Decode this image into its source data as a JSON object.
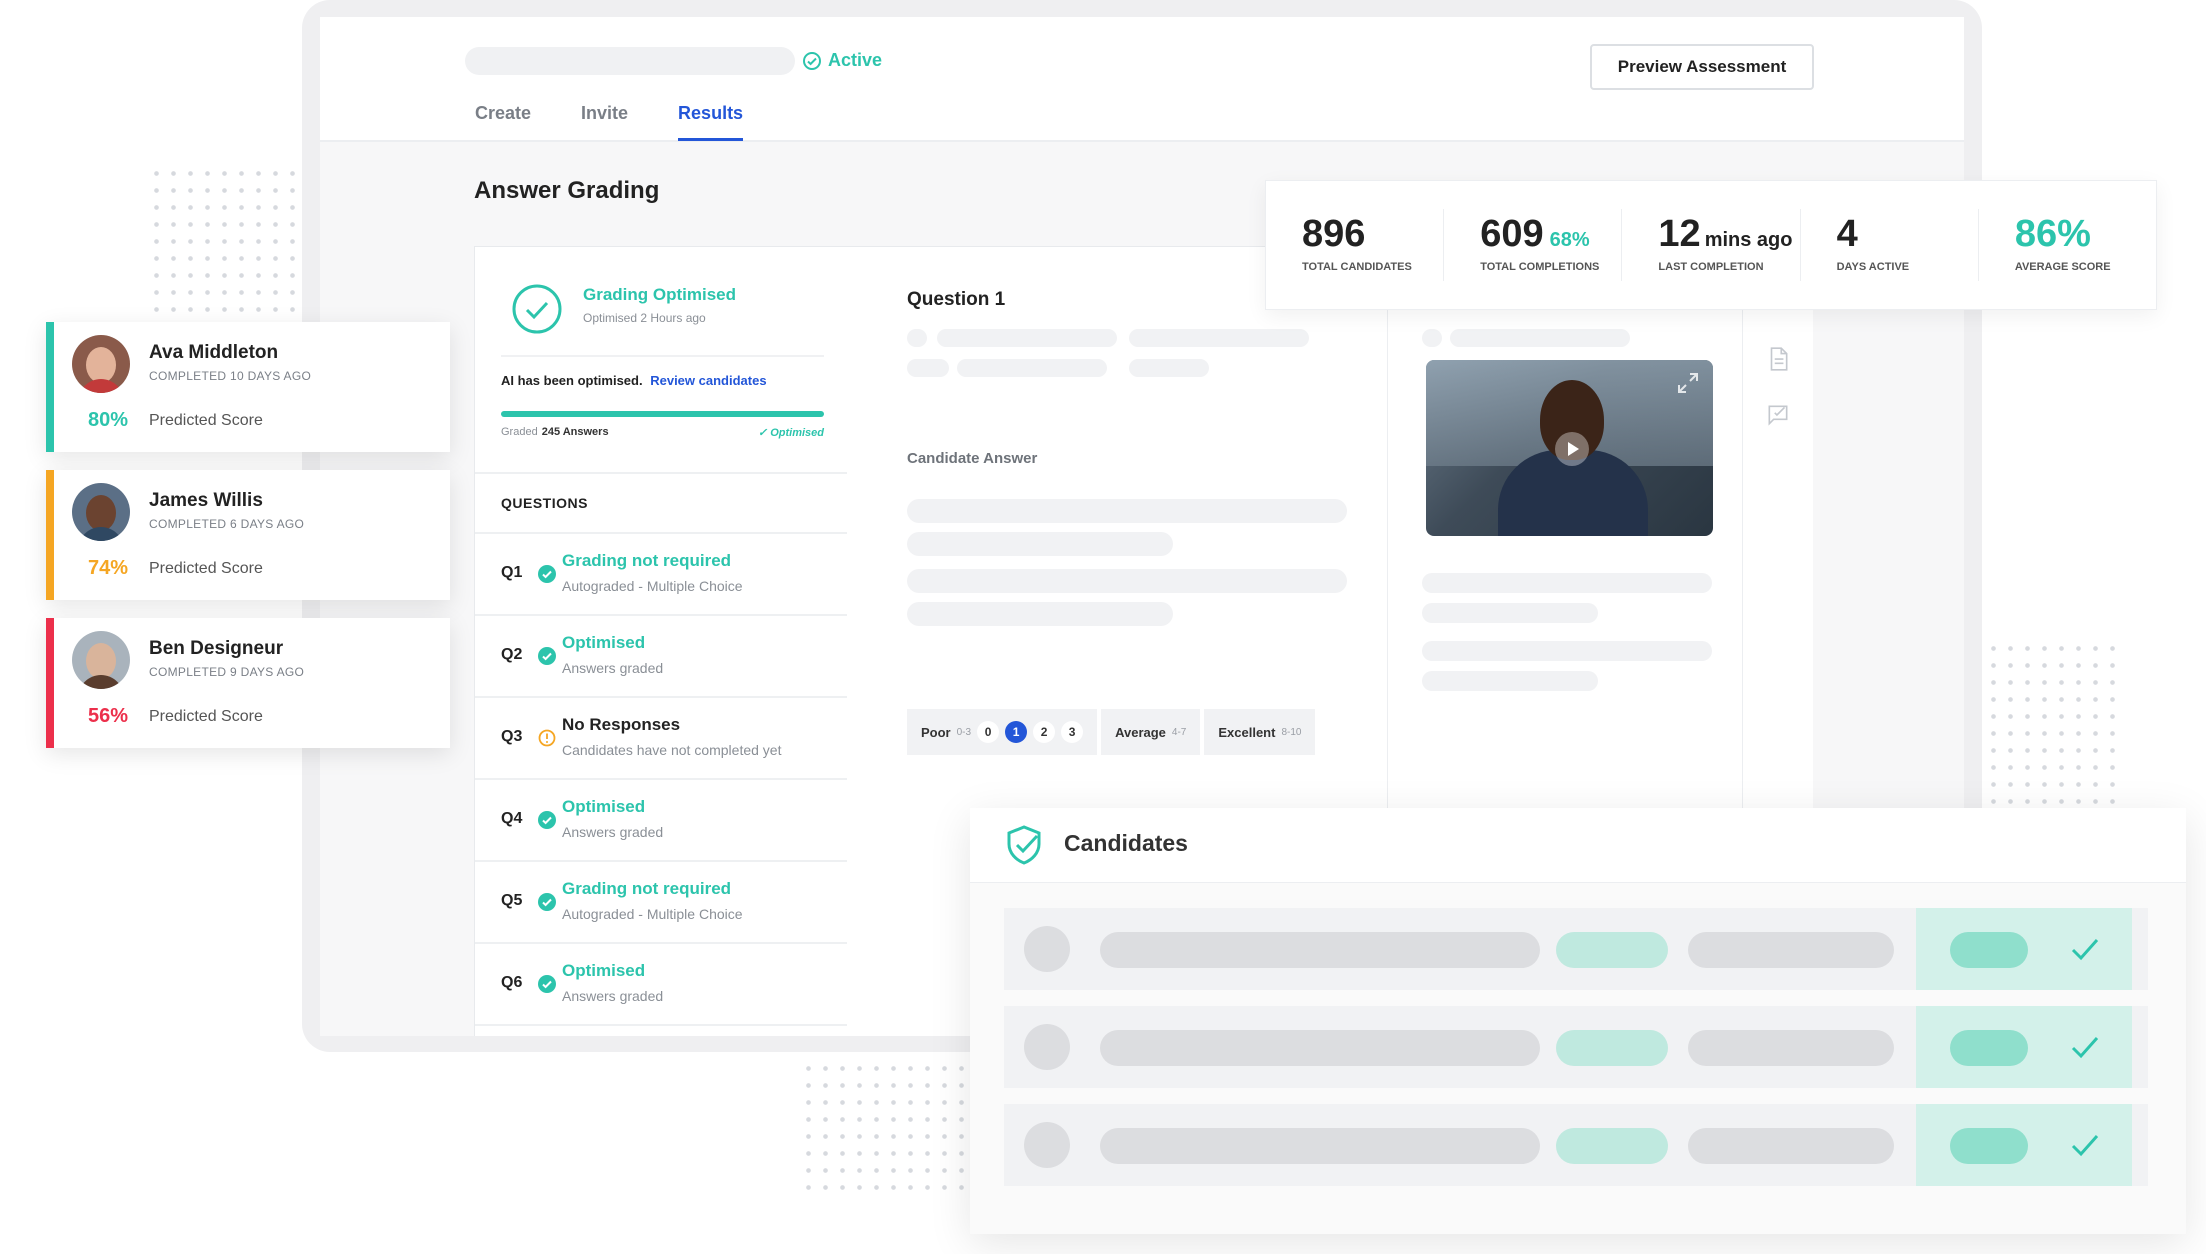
{
  "header": {
    "status": "Active",
    "preview_button": "Preview Assessment",
    "tabs": [
      "Create",
      "Invite",
      "Results"
    ],
    "active_tab": "Results"
  },
  "page_title": "Answer Grading",
  "grading": {
    "title": "Grading Optimised",
    "subtitle": "Optimised 2 Hours ago",
    "ai_text": "AI has been optimised.",
    "ai_link": "Review candidates",
    "graded_label": "Graded",
    "graded_value": "245 Answers",
    "optimised_label": "✓ Optimised",
    "progress": 1.0
  },
  "questions": {
    "header": "QUESTIONS",
    "items": [
      {
        "num": "Q1",
        "status": "Grading not required",
        "sub": "Autograded - Multiple Choice",
        "state": "ok"
      },
      {
        "num": "Q2",
        "status": "Optimised",
        "sub": "Answers graded",
        "state": "ok"
      },
      {
        "num": "Q3",
        "status": "No Responses",
        "sub": "Candidates have not completed yet",
        "state": "warn"
      },
      {
        "num": "Q4",
        "status": "Optimised",
        "sub": "Answers graded",
        "state": "ok"
      },
      {
        "num": "Q5",
        "status": "Grading not required",
        "sub": "Autograded - Multiple Choice",
        "state": "ok"
      },
      {
        "num": "Q6",
        "status": "Optimised",
        "sub": "Answers graded",
        "state": "ok"
      }
    ]
  },
  "question_detail": {
    "title": "Question 1",
    "candidate_answer_label": "Candidate Answer",
    "scale": {
      "poor": "Poor",
      "poor_range": "0-3",
      "numbers": [
        "0",
        "1",
        "2",
        "3"
      ],
      "selected": "1",
      "average": "Average",
      "average_range": "4-7",
      "excellent": "Excellent",
      "excellent_range": "8-10"
    }
  },
  "stats": [
    {
      "value": "896",
      "label": "TOTAL CANDIDATES"
    },
    {
      "value": "609",
      "extra": "68%",
      "label": "TOTAL COMPLETIONS"
    },
    {
      "value": "12",
      "unit": "mins ago",
      "label": "LAST COMPLETION"
    },
    {
      "value": "4",
      "label": "DAYS ACTIVE"
    },
    {
      "value": "86%",
      "label": "AVERAGE SCORE"
    }
  ],
  "candidates_cards": [
    {
      "name": "Ava Middleton",
      "completed": "COMPLETED 10 DAYS AGO",
      "score": "80%",
      "score_label": "Predicted Score",
      "color": "#2cc4ac"
    },
    {
      "name": "James Willis",
      "completed": "COMPLETED 6 DAYS AGO",
      "score": "74%",
      "score_label": "Predicted Score",
      "color": "#f5a623"
    },
    {
      "name": "Ben Designeur",
      "completed": "COMPLETED 9 DAYS AGO",
      "score": "56%",
      "score_label": "Predicted Score",
      "color": "#ec2f4b"
    }
  ],
  "candidates_panel": {
    "title": "Candidates"
  },
  "colors": {
    "accent": "#2cc4ac",
    "link": "#2356d8",
    "warning": "#f5a623",
    "danger": "#ec2f4b"
  }
}
